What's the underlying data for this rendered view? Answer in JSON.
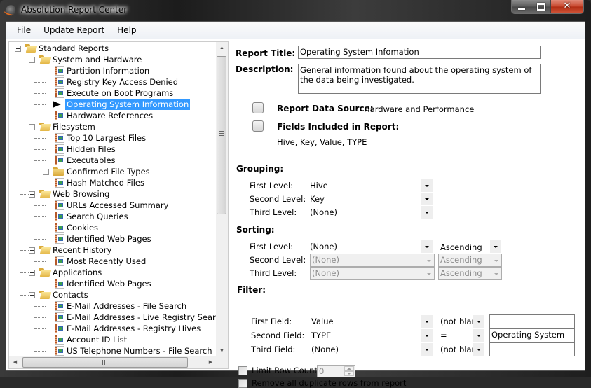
{
  "window": {
    "title": "Absolution Report Center",
    "controls": {
      "minimize": "minimize",
      "maximize": "maximize",
      "close": "✕"
    }
  },
  "menubar": {
    "items": [
      "File",
      "Update Report",
      "Help"
    ]
  },
  "tree": {
    "nodes": [
      {
        "label": "Standard Reports",
        "level": 0,
        "type": "folder-open",
        "expander": "minus"
      },
      {
        "label": "System and Hardware",
        "level": 1,
        "type": "folder-open",
        "expander": "minus"
      },
      {
        "label": "Partition Information",
        "level": 2,
        "type": "report"
      },
      {
        "label": "Registry Key Access Denied",
        "level": 2,
        "type": "report"
      },
      {
        "label": "Execute on Boot Programs",
        "level": 2,
        "type": "report"
      },
      {
        "label": "Operating System Information",
        "level": 2,
        "type": "arrow",
        "selected": true
      },
      {
        "label": "Hardware References",
        "level": 2,
        "type": "report"
      },
      {
        "label": "Filesystem",
        "level": 1,
        "type": "folder-open",
        "expander": "minus"
      },
      {
        "label": "Top 10 Largest Files",
        "level": 2,
        "type": "report"
      },
      {
        "label": "Hidden Files",
        "level": 2,
        "type": "report"
      },
      {
        "label": "Executables",
        "level": 2,
        "type": "report"
      },
      {
        "label": "Confirmed File Types",
        "level": 2,
        "type": "folder-closed",
        "expander": "plus"
      },
      {
        "label": "Hash Matched Files",
        "level": 2,
        "type": "report"
      },
      {
        "label": "Web Browsing",
        "level": 1,
        "type": "folder-open",
        "expander": "minus"
      },
      {
        "label": "URLs Accessed Summary",
        "level": 2,
        "type": "report"
      },
      {
        "label": "Search Queries",
        "level": 2,
        "type": "report"
      },
      {
        "label": "Cookies",
        "level": 2,
        "type": "report"
      },
      {
        "label": "Identified Web Pages",
        "level": 2,
        "type": "report"
      },
      {
        "label": "Recent History",
        "level": 1,
        "type": "folder-open",
        "expander": "minus"
      },
      {
        "label": "Most Recently Used",
        "level": 2,
        "type": "report"
      },
      {
        "label": "Applications",
        "level": 1,
        "type": "folder-open",
        "expander": "minus"
      },
      {
        "label": "Identified Web Pages",
        "level": 2,
        "type": "report"
      },
      {
        "label": "Contacts",
        "level": 1,
        "type": "folder-open",
        "expander": "minus"
      },
      {
        "label": "E-Mail Addresses - File Search",
        "level": 2,
        "type": "report"
      },
      {
        "label": "E-Mail Addresses - Live Registry Search",
        "level": 2,
        "type": "report"
      },
      {
        "label": "E-Mail Addresses - Registry Hives",
        "level": 2,
        "type": "report"
      },
      {
        "label": "Account ID List",
        "level": 2,
        "type": "report"
      },
      {
        "label": "US Telephone Numbers - File Search",
        "level": 2,
        "type": "report"
      }
    ]
  },
  "report": {
    "title_label": "Report Title:",
    "title_value": "Operating System Infomation",
    "description_label": "Description:",
    "description_value": "General information found about the operating system of the data being investigated.",
    "data_source_label": "Report Data Source:",
    "data_source_value": "Hardware and Performance",
    "fields_label": "Fields Included in Report:",
    "fields_value": "Hive, Key, Value, TYPE"
  },
  "grouping": {
    "heading": "Grouping:",
    "rows": [
      {
        "label": "First Level:",
        "value": "Hive"
      },
      {
        "label": "Second Level:",
        "value": "Key"
      },
      {
        "label": "Third Level:",
        "value": "(None)"
      }
    ]
  },
  "sorting": {
    "heading": "Sorting:",
    "rows": [
      {
        "label": "First Level:",
        "value": "(None)",
        "order": "Ascending",
        "enabled": true
      },
      {
        "label": "Second Level:",
        "value": "(None)",
        "order": "Ascending",
        "enabled": false
      },
      {
        "label": "Third Level:",
        "value": "(None)",
        "order": "Ascending",
        "enabled": false
      }
    ]
  },
  "filter": {
    "heading": "Filter:",
    "rows": [
      {
        "label": "First Field:",
        "field": "Value",
        "operator": "(not blank",
        "value": ""
      },
      {
        "label": "Second Field:",
        "field": "TYPE",
        "operator": "=",
        "value": "Operating System"
      },
      {
        "label": "Third Field:",
        "field": "(None)",
        "operator": "(not blank",
        "value": ""
      }
    ]
  },
  "options": {
    "limit_label": "Limit Row Count to",
    "limit_value": "0",
    "limit_checked": false,
    "dedupe_label": "Remove all duplicate rows from report",
    "dedupe_checked": false
  }
}
